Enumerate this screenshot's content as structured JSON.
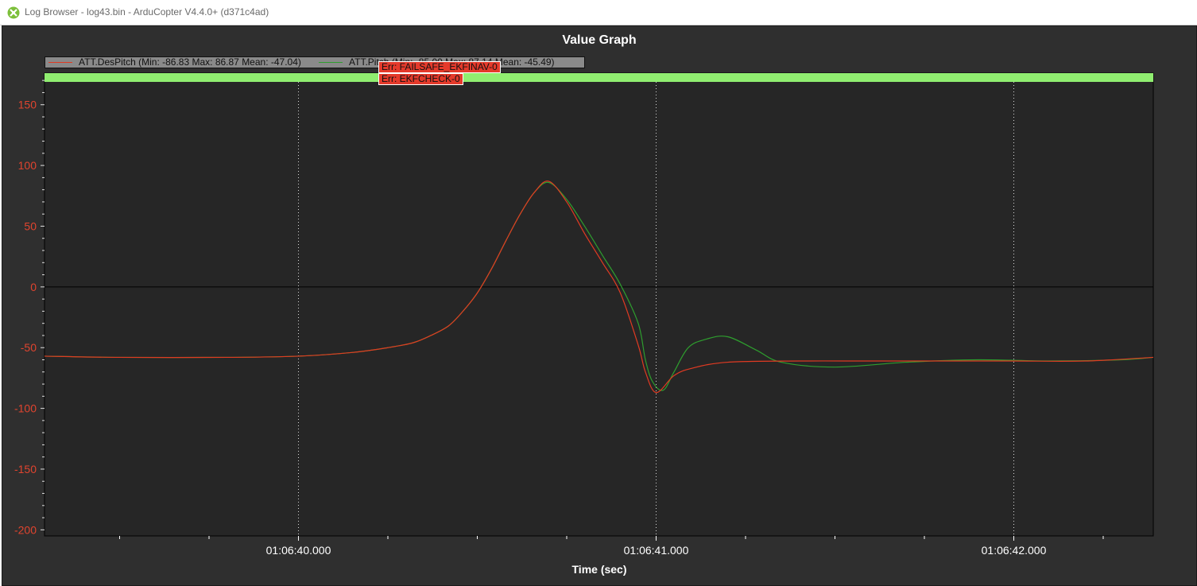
{
  "window": {
    "title": "Log Browser - log43.bin - ArduCopter V4.4.0+ (d371c4ad)"
  },
  "colors": {
    "background": "#2f2f2f",
    "plot_background": "#262626",
    "despitch_line": "#e03a22",
    "pitch_line": "#2e9e2e",
    "y_tick_text": "#e0442f",
    "mode_band": "#90ee70",
    "err_tag": "#e53a2b"
  },
  "legend": [
    {
      "name": "ATT.DesPitch",
      "text": "ATT.DesPitch  (Min: -86.83 Max: 86.87 Mean: -47.04)",
      "color": "#e03a22"
    },
    {
      "name": "ATT.Pitch",
      "text": "ATT.Pitch  (Min: -85.00 Max: 87.14 Mean: -45.49)",
      "color": "#2e9e2e"
    }
  ],
  "error_tags": [
    {
      "label": "Err: FAILSAFE_EKFINAV-0"
    },
    {
      "label": "Err: EKFCHECK-0"
    }
  ],
  "chart_data": {
    "type": "line",
    "title": "Value Graph",
    "xlabel": "Time (sec)",
    "ylabel": "",
    "x_unit": "seconds",
    "x_ticks": [
      {
        "t": 40.0,
        "label": "01:06:40.000"
      },
      {
        "t": 41.0,
        "label": "01:06:41.000"
      },
      {
        "t": 42.0,
        "label": "01:06:42.000"
      }
    ],
    "xlim": [
      39.29,
      42.39
    ],
    "ylim": [
      -205,
      176
    ],
    "y_ticks": [
      150,
      100,
      50,
      0,
      -50,
      -100,
      -150,
      -200
    ],
    "grid": "vertical dotted at major x ticks",
    "legend_position": "top-left",
    "series": [
      {
        "name": "ATT.DesPitch",
        "color": "#e03a22",
        "x": [
          39.29,
          39.5,
          39.8,
          40.0,
          40.15,
          40.25,
          40.32,
          40.37,
          40.42,
          40.46,
          40.5,
          40.54,
          40.58,
          40.62,
          40.66,
          40.7,
          40.75,
          40.8,
          40.85,
          40.9,
          40.95,
          40.97,
          41.0,
          41.05,
          41.1,
          41.2,
          41.4,
          41.6,
          41.8,
          42.0,
          42.2,
          42.39
        ],
        "y": [
          -57,
          -58,
          -58,
          -57,
          -54,
          -50,
          -46,
          -40,
          -32,
          -20,
          -5,
          15,
          38,
          60,
          78,
          87,
          70,
          44,
          20,
          -5,
          -48,
          -70,
          -87,
          -73,
          -67,
          -62,
          -61,
          -61,
          -61,
          -61,
          -61,
          -58
        ]
      },
      {
        "name": "ATT.Pitch",
        "color": "#2e9e2e",
        "x": [
          39.29,
          39.5,
          39.8,
          40.0,
          40.15,
          40.25,
          40.32,
          40.37,
          40.42,
          40.46,
          40.5,
          40.54,
          40.58,
          40.62,
          40.66,
          40.7,
          40.75,
          40.8,
          40.85,
          40.9,
          40.95,
          40.97,
          40.99,
          41.02,
          41.05,
          41.09,
          41.14,
          41.2,
          41.28,
          41.35,
          41.5,
          41.7,
          41.9,
          42.1,
          42.3,
          42.39
        ],
        "y": [
          -57,
          -58,
          -58,
          -57,
          -54,
          -50,
          -46,
          -40,
          -32,
          -20,
          -5,
          15,
          38,
          60,
          78,
          86,
          72,
          50,
          26,
          2,
          -30,
          -60,
          -78,
          -85,
          -70,
          -50,
          -43,
          -41,
          -52,
          -62,
          -66,
          -62,
          -60,
          -61,
          -60,
          -58
        ]
      }
    ]
  }
}
